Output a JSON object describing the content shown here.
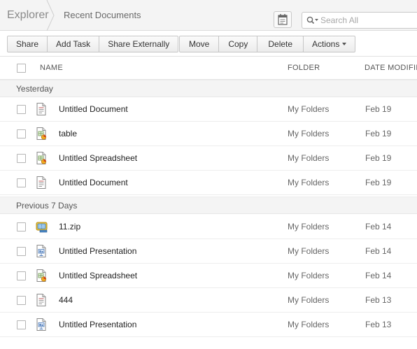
{
  "header": {
    "root": "Explorer",
    "current": "Recent Documents",
    "search_placeholder": "Search All"
  },
  "toolbar": {
    "share": "Share",
    "add_task": "Add Task",
    "share_externally": "Share Externally",
    "move": "Move",
    "copy": "Copy",
    "delete": "Delete",
    "actions": "Actions"
  },
  "columns": {
    "name": "NAME",
    "folder": "FOLDER",
    "date": "DATE MODIFIE"
  },
  "groups": [
    {
      "label": "Yesterday",
      "rows": [
        {
          "name": "Untitled Document",
          "folder": "My Folders",
          "date": "Feb 19",
          "icon": "document-icon"
        },
        {
          "name": "table",
          "folder": "My Folders",
          "date": "Feb 19",
          "icon": "spreadsheet-icon"
        },
        {
          "name": "Untitled Spreadsheet",
          "folder": "My Folders",
          "date": "Feb 19",
          "icon": "spreadsheet-icon"
        },
        {
          "name": "Untitled Document",
          "folder": "My Folders",
          "date": "Feb 19",
          "icon": "document-icon"
        }
      ]
    },
    {
      "label": "Previous 7 Days",
      "rows": [
        {
          "name": "11.zip",
          "folder": "My Folders",
          "date": "Feb 14",
          "icon": "zip-icon"
        },
        {
          "name": "Untitled Presentation",
          "folder": "My Folders",
          "date": "Feb 14",
          "icon": "presentation-icon"
        },
        {
          "name": "Untitled Spreadsheet",
          "folder": "My Folders",
          "date": "Feb 14",
          "icon": "spreadsheet-icon"
        },
        {
          "name": "444",
          "folder": "My Folders",
          "date": "Feb 13",
          "icon": "document-icon"
        },
        {
          "name": "Untitled Presentation",
          "folder": "My Folders",
          "date": "Feb 13",
          "icon": "presentation-icon"
        }
      ]
    }
  ]
}
